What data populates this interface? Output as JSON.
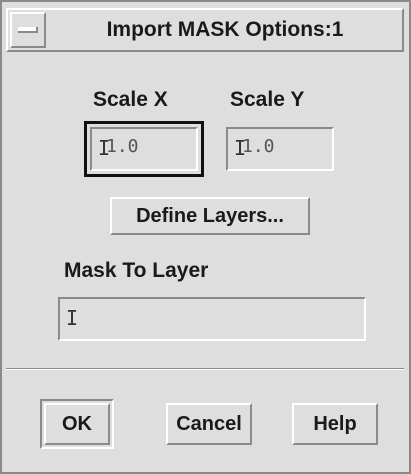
{
  "dialog": {
    "title": "Import MASK Options:1"
  },
  "scale": {
    "x_label": "Scale X",
    "y_label": "Scale Y",
    "x_value": "1.0",
    "y_value": "1.0"
  },
  "buttons": {
    "define_layers": "Define Layers...",
    "ok": "OK",
    "cancel": "Cancel",
    "help": "Help"
  },
  "mask_to_layer": {
    "label": "Mask To Layer",
    "value": ""
  },
  "icons": {
    "window_menu": "window-menu-icon",
    "text_cursor": "text-cursor-icon"
  },
  "colors": {
    "background": "#dedede",
    "shadow": "#8a8a8a",
    "highlight": "#ffffff",
    "text": "#1a1a1a"
  }
}
